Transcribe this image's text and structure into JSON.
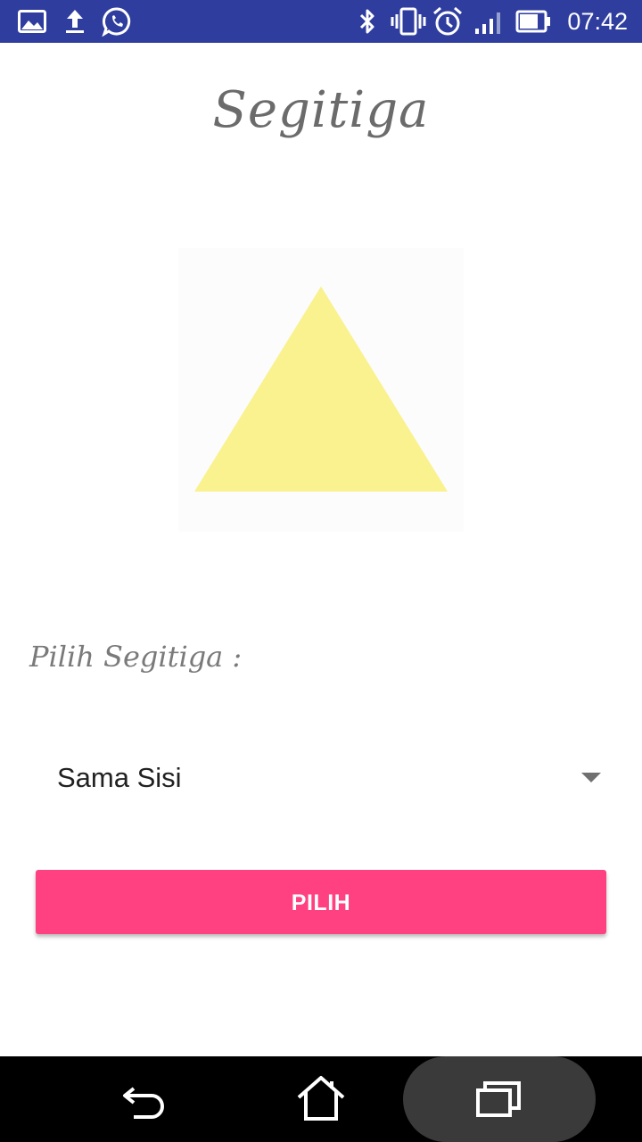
{
  "status_bar": {
    "time": "07:42",
    "background": "#2f3e9e",
    "left_icons": [
      "gallery-icon",
      "upload-icon",
      "whatsapp-icon"
    ],
    "right_icons": [
      "bluetooth-icon",
      "vibrate-icon",
      "alarm-icon",
      "signal-icon",
      "battery-icon"
    ]
  },
  "page": {
    "title": "Segitiga",
    "image": {
      "shape": "triangle-icon",
      "fill_color": "#f9f28f"
    },
    "select_label": "Pilih Segitiga :",
    "spinner": {
      "selected_value": "Sama Sisi"
    },
    "button": {
      "label": "PILIH",
      "color": "#ff4081"
    }
  },
  "nav_bar": {
    "buttons": [
      "back-icon",
      "home-icon",
      "recents-icon"
    ]
  }
}
